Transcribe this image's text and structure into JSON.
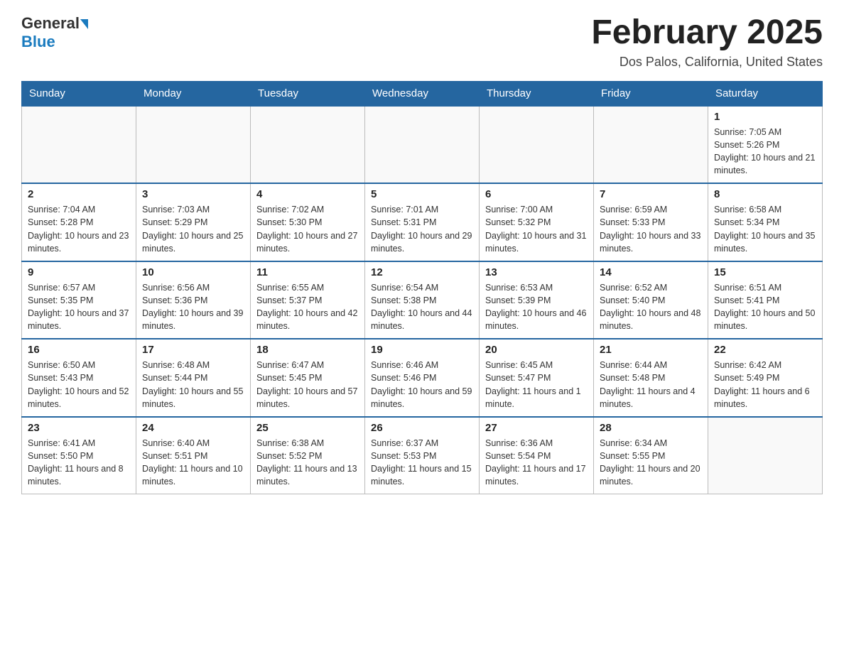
{
  "header": {
    "logo_general": "General",
    "logo_blue": "Blue",
    "month_title": "February 2025",
    "location": "Dos Palos, California, United States"
  },
  "weekdays": [
    "Sunday",
    "Monday",
    "Tuesday",
    "Wednesday",
    "Thursday",
    "Friday",
    "Saturday"
  ],
  "weeks": [
    [
      {
        "day": "",
        "info": ""
      },
      {
        "day": "",
        "info": ""
      },
      {
        "day": "",
        "info": ""
      },
      {
        "day": "",
        "info": ""
      },
      {
        "day": "",
        "info": ""
      },
      {
        "day": "",
        "info": ""
      },
      {
        "day": "1",
        "info": "Sunrise: 7:05 AM\nSunset: 5:26 PM\nDaylight: 10 hours and 21 minutes."
      }
    ],
    [
      {
        "day": "2",
        "info": "Sunrise: 7:04 AM\nSunset: 5:28 PM\nDaylight: 10 hours and 23 minutes."
      },
      {
        "day": "3",
        "info": "Sunrise: 7:03 AM\nSunset: 5:29 PM\nDaylight: 10 hours and 25 minutes."
      },
      {
        "day": "4",
        "info": "Sunrise: 7:02 AM\nSunset: 5:30 PM\nDaylight: 10 hours and 27 minutes."
      },
      {
        "day": "5",
        "info": "Sunrise: 7:01 AM\nSunset: 5:31 PM\nDaylight: 10 hours and 29 minutes."
      },
      {
        "day": "6",
        "info": "Sunrise: 7:00 AM\nSunset: 5:32 PM\nDaylight: 10 hours and 31 minutes."
      },
      {
        "day": "7",
        "info": "Sunrise: 6:59 AM\nSunset: 5:33 PM\nDaylight: 10 hours and 33 minutes."
      },
      {
        "day": "8",
        "info": "Sunrise: 6:58 AM\nSunset: 5:34 PM\nDaylight: 10 hours and 35 minutes."
      }
    ],
    [
      {
        "day": "9",
        "info": "Sunrise: 6:57 AM\nSunset: 5:35 PM\nDaylight: 10 hours and 37 minutes."
      },
      {
        "day": "10",
        "info": "Sunrise: 6:56 AM\nSunset: 5:36 PM\nDaylight: 10 hours and 39 minutes."
      },
      {
        "day": "11",
        "info": "Sunrise: 6:55 AM\nSunset: 5:37 PM\nDaylight: 10 hours and 42 minutes."
      },
      {
        "day": "12",
        "info": "Sunrise: 6:54 AM\nSunset: 5:38 PM\nDaylight: 10 hours and 44 minutes."
      },
      {
        "day": "13",
        "info": "Sunrise: 6:53 AM\nSunset: 5:39 PM\nDaylight: 10 hours and 46 minutes."
      },
      {
        "day": "14",
        "info": "Sunrise: 6:52 AM\nSunset: 5:40 PM\nDaylight: 10 hours and 48 minutes."
      },
      {
        "day": "15",
        "info": "Sunrise: 6:51 AM\nSunset: 5:41 PM\nDaylight: 10 hours and 50 minutes."
      }
    ],
    [
      {
        "day": "16",
        "info": "Sunrise: 6:50 AM\nSunset: 5:43 PM\nDaylight: 10 hours and 52 minutes."
      },
      {
        "day": "17",
        "info": "Sunrise: 6:48 AM\nSunset: 5:44 PM\nDaylight: 10 hours and 55 minutes."
      },
      {
        "day": "18",
        "info": "Sunrise: 6:47 AM\nSunset: 5:45 PM\nDaylight: 10 hours and 57 minutes."
      },
      {
        "day": "19",
        "info": "Sunrise: 6:46 AM\nSunset: 5:46 PM\nDaylight: 10 hours and 59 minutes."
      },
      {
        "day": "20",
        "info": "Sunrise: 6:45 AM\nSunset: 5:47 PM\nDaylight: 11 hours and 1 minute."
      },
      {
        "day": "21",
        "info": "Sunrise: 6:44 AM\nSunset: 5:48 PM\nDaylight: 11 hours and 4 minutes."
      },
      {
        "day": "22",
        "info": "Sunrise: 6:42 AM\nSunset: 5:49 PM\nDaylight: 11 hours and 6 minutes."
      }
    ],
    [
      {
        "day": "23",
        "info": "Sunrise: 6:41 AM\nSunset: 5:50 PM\nDaylight: 11 hours and 8 minutes."
      },
      {
        "day": "24",
        "info": "Sunrise: 6:40 AM\nSunset: 5:51 PM\nDaylight: 11 hours and 10 minutes."
      },
      {
        "day": "25",
        "info": "Sunrise: 6:38 AM\nSunset: 5:52 PM\nDaylight: 11 hours and 13 minutes."
      },
      {
        "day": "26",
        "info": "Sunrise: 6:37 AM\nSunset: 5:53 PM\nDaylight: 11 hours and 15 minutes."
      },
      {
        "day": "27",
        "info": "Sunrise: 6:36 AM\nSunset: 5:54 PM\nDaylight: 11 hours and 17 minutes."
      },
      {
        "day": "28",
        "info": "Sunrise: 6:34 AM\nSunset: 5:55 PM\nDaylight: 11 hours and 20 minutes."
      },
      {
        "day": "",
        "info": ""
      }
    ]
  ]
}
